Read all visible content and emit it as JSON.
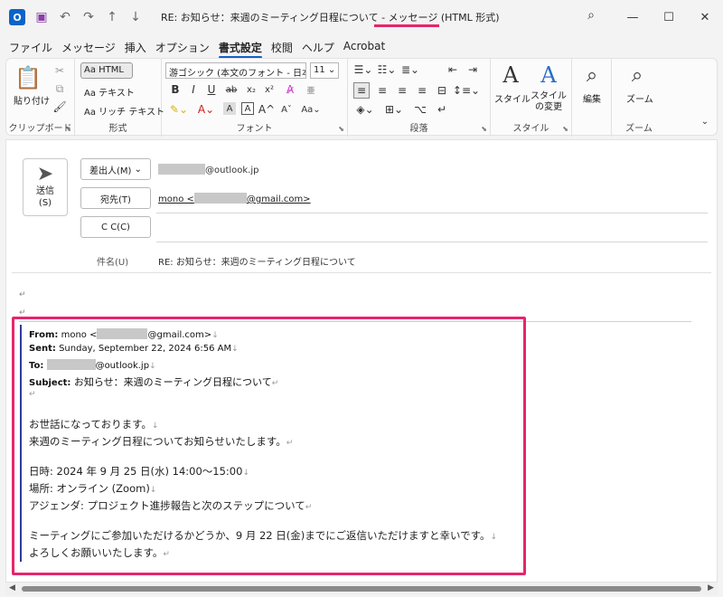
{
  "window": {
    "title_prefix": "RE: お知らせ：来週のミーティング日程について  -  メッセージ",
    "title_format": "(HTML 形式)"
  },
  "menu": [
    "ファイル",
    "メッセージ",
    "挿入",
    "オプション",
    "書式設定",
    "校閲",
    "ヘルプ",
    "Acrobat"
  ],
  "ribbon": {
    "clipboard": {
      "paste": "貼り付け",
      "label": "クリップボード"
    },
    "format": {
      "html": "Aa HTML",
      "text": "Aa テキスト",
      "rich": "Aa リッチ テキスト",
      "label": "形式"
    },
    "font": {
      "family": "游ゴシック (本文のフォント - 日本語",
      "size": "11",
      "label": "フォント"
    },
    "paragraph": {
      "label": "段落"
    },
    "style": {
      "style": "スタイル",
      "change": "スタイルの変更",
      "label": "スタイル"
    },
    "edit": {
      "label": "編集"
    },
    "zoom": {
      "zoom": "ズーム",
      "label": "ズーム"
    }
  },
  "compose": {
    "send": "送信",
    "send_key": "(S)",
    "from_btn": "差出人(M)",
    "from_value": "@outlook.jp",
    "to_btn": "宛先(T)",
    "to_prefix": "mono <",
    "to_suffix": "@gmail.com>",
    "cc_btn": "C C(C)",
    "subject_label": "件名(U)",
    "subject_value": "RE: お知らせ：来週のミーティング日程について"
  },
  "quoted": {
    "from_label": "From:",
    "from_prefix": "mono <",
    "from_suffix": "@gmail.com>",
    "sent_label": "Sent:",
    "sent_value": "Sunday, September 22, 2024 6:56 AM",
    "to_label": "To:",
    "to_suffix": "@outlook.jp",
    "subject_label": "Subject:",
    "subject_value": "お知らせ：来週のミーティング日程について",
    "greeting": "お世話になっております。",
    "intro": "来週のミーティング日程についてお知らせいたします。",
    "date": "日時: 2024 年 9 月 25 日(水) 14:00～15:00",
    "place": "場所: オンライン (Zoom)",
    "agenda": "アジェンダ: プロジェクト進捗報告と次のステップについて",
    "request": "ミーティングにご参加いただけるかどうか、9 月 22 日(金)までにご返信いただけますと幸いです。",
    "closing": "よろしくお願いいたします。"
  }
}
